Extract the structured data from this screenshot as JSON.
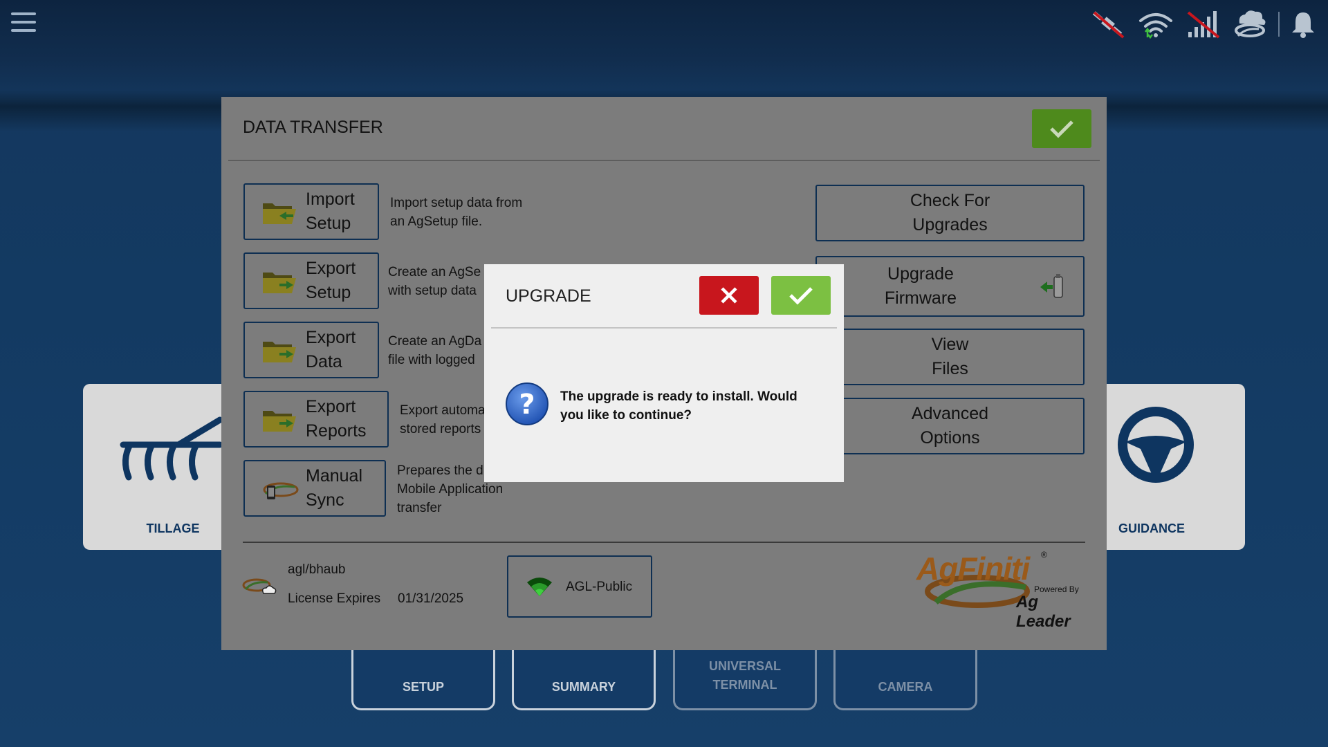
{
  "background": {
    "cards": {
      "tillage": "TILLAGE",
      "guidance": "GUIDANCE"
    },
    "tabs": [
      "SETUP",
      "SUMMARY",
      "UNIVERSAL\nTERMINAL",
      "CAMERA"
    ]
  },
  "data_transfer": {
    "title": "DATA TRANSFER",
    "left_buttons": [
      {
        "label": "Import\nSetup",
        "desc": "Import setup data from\nan AgSetup file."
      },
      {
        "label": "Export\nSetup",
        "desc": "Create an AgSe\nwith setup data"
      },
      {
        "label": "Export\nData",
        "desc": "Create an AgDa\nfile with logged"
      },
      {
        "label": "Export\nReports",
        "desc": "Export automa\nstored reports"
      },
      {
        "label": "Manual\nSync",
        "desc": "Prepares the d\nMobile Application\ntransfer"
      }
    ],
    "right_buttons": [
      "Check For\nUpgrades",
      "Upgrade\nFirmware",
      "View\nFiles",
      "Advanced\nOptions"
    ],
    "footer": {
      "user": "agl/bhaub",
      "license_label": "License Expires",
      "license_date": "01/31/2025",
      "network": "AGL-Public",
      "logo_main": "AgFiniti",
      "logo_reg": "®",
      "logo_powered": "Powered By",
      "logo_brand": "Ag Leader"
    }
  },
  "upgrade_dialog": {
    "title": "UPGRADE",
    "message": "The upgrade is ready to install.  Would you like to continue?"
  },
  "colors": {
    "confirm": "#7cc042",
    "cancel": "#c8161d",
    "navy": "#0e3560"
  }
}
